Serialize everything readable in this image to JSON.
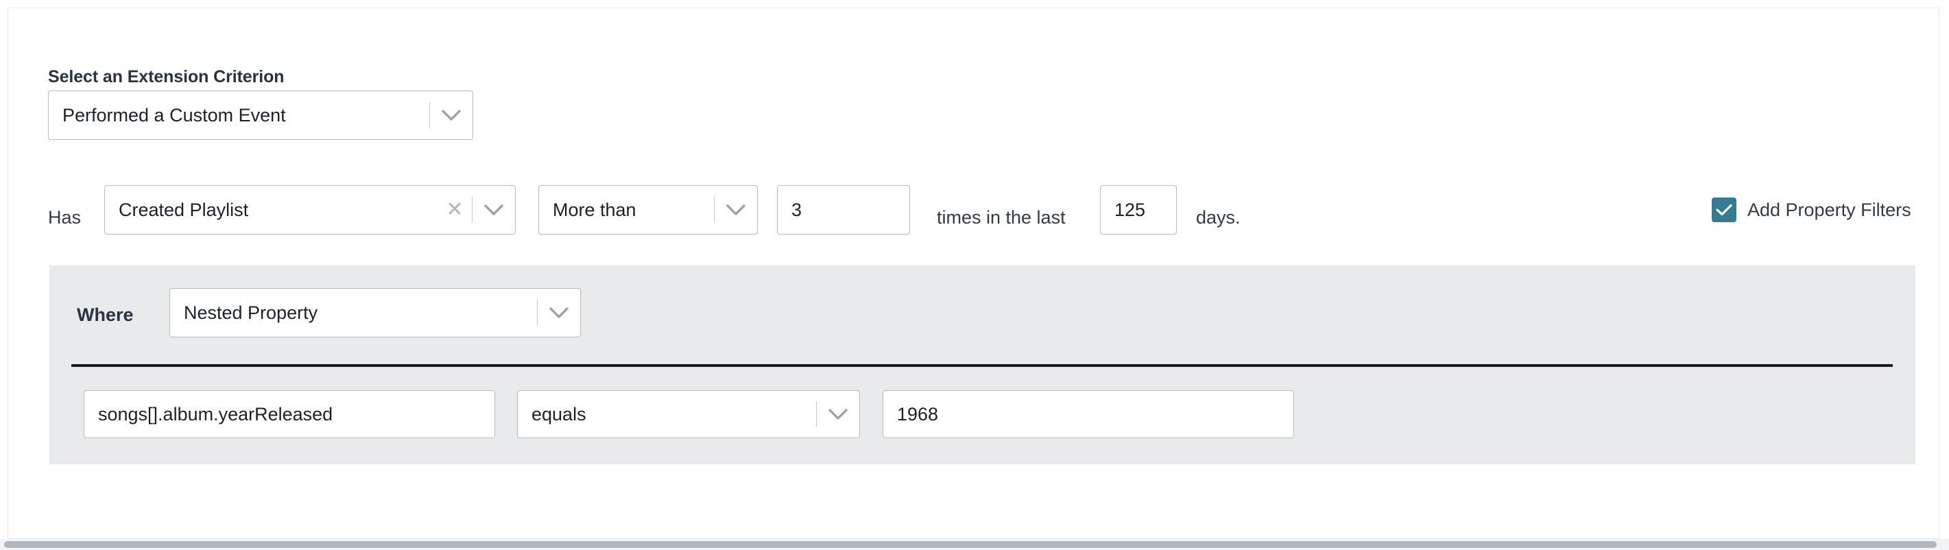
{
  "section": {
    "label": "Select an Extension Criterion"
  },
  "criterion": {
    "value": "Performed a Custom Event",
    "caret_icon": "chevron-down-icon"
  },
  "rule_row": {
    "has_label": "Has",
    "event": {
      "value": "Created Playlist",
      "clear_icon": "close-icon",
      "caret_icon": "chevron-down-icon"
    },
    "operator": {
      "value": "More than",
      "caret_icon": "chevron-down-icon"
    },
    "count": {
      "value": "3"
    },
    "middle_label": "times in the last",
    "days": {
      "value": "125"
    },
    "trailing_label": "days."
  },
  "add_property_filters": {
    "label": "Add Property Filters",
    "checked": true,
    "check_icon": "check-icon",
    "accent_color": "#357b91"
  },
  "nested_panel": {
    "where_label": "Where",
    "property_type": {
      "value": "Nested Property",
      "caret_icon": "chevron-down-icon"
    },
    "filter": {
      "property_path": "songs[].album.yearReleased",
      "comparator": "equals",
      "comparator_caret_icon": "chevron-down-icon",
      "value": "1968"
    },
    "background_color": "#e9eaec",
    "divider_color": "#131b28"
  }
}
